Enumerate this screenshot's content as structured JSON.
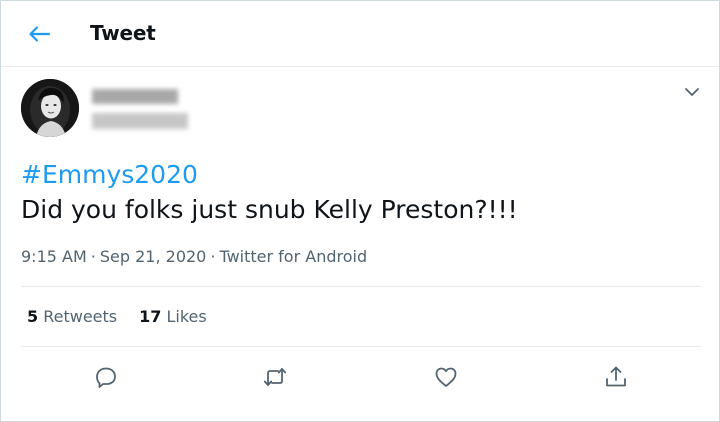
{
  "header": {
    "title": "Tweet",
    "back_icon": "arrow-left-icon"
  },
  "tweet": {
    "hashtag": "#Emmys2020",
    "text": "Did you folks just snub Kelly Preston?!!!",
    "time": "9:15 AM",
    "date": "Sep 21, 2020",
    "source": "Twitter for Android",
    "separator": "·",
    "menu_icon": "chevron-down-icon"
  },
  "stats": {
    "retweets_count": "5",
    "retweets_label": "Retweets",
    "likes_count": "17",
    "likes_label": "Likes"
  },
  "actions": [
    "reply-icon",
    "retweet-icon",
    "like-icon",
    "share-icon"
  ],
  "colors": {
    "accent": "#1d9bf0",
    "text": "#0f1419",
    "secondary": "#536471",
    "divider": "#e6ecf0"
  }
}
